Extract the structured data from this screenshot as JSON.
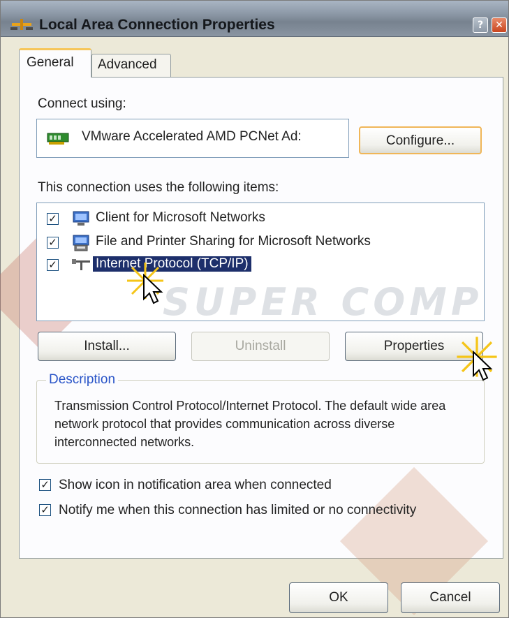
{
  "window": {
    "title": "Local Area Connection Properties",
    "help_glyph": "?",
    "close_glyph": "✕"
  },
  "tabs": [
    {
      "label": "General",
      "active": true
    },
    {
      "label": "Advanced",
      "active": false
    }
  ],
  "connect_using": {
    "label": "Connect using:",
    "adapter": "VMware Accelerated AMD PCNet Ad:",
    "configure_button": "Configure..."
  },
  "items_section": {
    "label": "This connection uses the following items:",
    "items": [
      {
        "label": "Client for Microsoft Networks",
        "checked": true,
        "icon": "network-client-icon",
        "selected": false
      },
      {
        "label": "File and Printer Sharing for Microsoft Networks",
        "checked": true,
        "icon": "printer-sharing-icon",
        "selected": false
      },
      {
        "label": "Internet Protocol (TCP/IP)",
        "checked": true,
        "icon": "network-protocol-icon",
        "selected": true
      }
    ]
  },
  "buttons": {
    "install": "Install...",
    "uninstall": "Uninstall",
    "properties": "Properties"
  },
  "description": {
    "legend": "Description",
    "text": "Transmission Control Protocol/Internet Protocol. The default wide area network protocol that provides communication across diverse interconnected networks."
  },
  "options": [
    {
      "label": "Show icon in notification area when connected",
      "checked": true
    },
    {
      "label": "Notify me when this connection has limited or no connectivity",
      "checked": true
    }
  ],
  "footer": {
    "ok": "OK",
    "cancel": "Cancel"
  },
  "watermark": "SUPER COMPUTER",
  "colors": {
    "title_bar": "#8e9aa8",
    "selection": "#1d2f6b",
    "legend_text": "#2a55c8",
    "focus_border": "#f0b658"
  }
}
